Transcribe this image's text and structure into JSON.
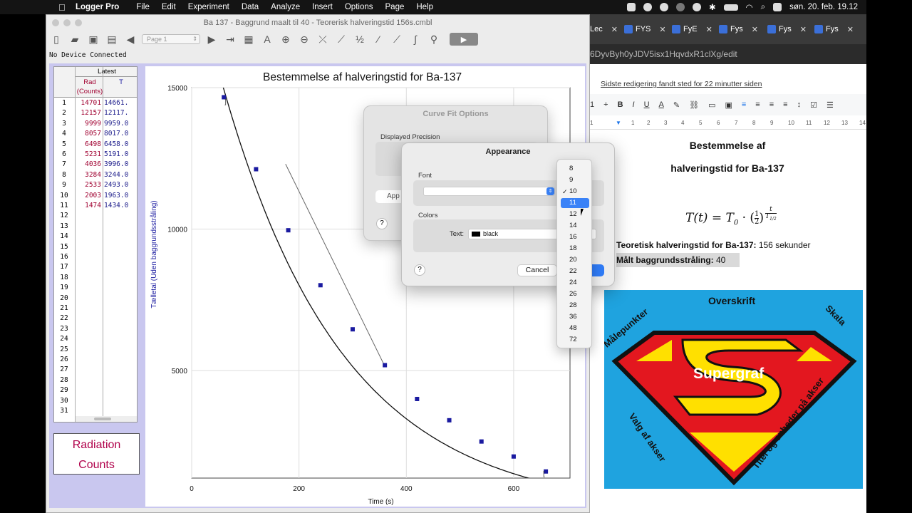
{
  "menubar": {
    "app": "Logger Pro",
    "items": [
      "File",
      "Edit",
      "Experiment",
      "Data",
      "Analyze",
      "Insert",
      "Options",
      "Page",
      "Help"
    ],
    "clock": "søn. 20. feb. 19.12"
  },
  "logger_window": {
    "title": "Ba 137 - Baggrund maalt til 40 - Teorerisk halveringstid 156s.cmbl",
    "page_select": "Page 1",
    "status": "No Device Connected"
  },
  "table": {
    "group": "Latest",
    "col1_header_line1": "Rad",
    "col1_header_line2": "(Counts)",
    "col2_header": "T",
    "rows": [
      {
        "n": "1",
        "a": "14701",
        "b": "14661."
      },
      {
        "n": "2",
        "a": "12157",
        "b": "12117."
      },
      {
        "n": "3",
        "a": "9999",
        "b": "9959.0"
      },
      {
        "n": "4",
        "a": "8057",
        "b": "8017.0"
      },
      {
        "n": "5",
        "a": "6498",
        "b": "6458.0"
      },
      {
        "n": "6",
        "a": "5231",
        "b": "5191.0"
      },
      {
        "n": "7",
        "a": "4036",
        "b": "3996.0"
      },
      {
        "n": "8",
        "a": "3284",
        "b": "3244.0"
      },
      {
        "n": "9",
        "a": "2533",
        "b": "2493.0"
      },
      {
        "n": "10",
        "a": "2003",
        "b": "1963.0"
      },
      {
        "n": "11",
        "a": "1474",
        "b": "1434.0"
      },
      {
        "n": "12",
        "a": "",
        "b": ""
      },
      {
        "n": "13",
        "a": "",
        "b": ""
      },
      {
        "n": "14",
        "a": "",
        "b": ""
      },
      {
        "n": "15",
        "a": "",
        "b": ""
      },
      {
        "n": "16",
        "a": "",
        "b": ""
      },
      {
        "n": "17",
        "a": "",
        "b": ""
      },
      {
        "n": "18",
        "a": "",
        "b": ""
      },
      {
        "n": "19",
        "a": "",
        "b": ""
      },
      {
        "n": "20",
        "a": "",
        "b": ""
      },
      {
        "n": "21",
        "a": "",
        "b": ""
      },
      {
        "n": "22",
        "a": "",
        "b": ""
      },
      {
        "n": "23",
        "a": "",
        "b": ""
      },
      {
        "n": "24",
        "a": "",
        "b": ""
      },
      {
        "n": "25",
        "a": "",
        "b": ""
      },
      {
        "n": "26",
        "a": "",
        "b": ""
      },
      {
        "n": "27",
        "a": "",
        "b": ""
      },
      {
        "n": "28",
        "a": "",
        "b": ""
      },
      {
        "n": "29",
        "a": "",
        "b": ""
      },
      {
        "n": "30",
        "a": "",
        "b": ""
      },
      {
        "n": "31",
        "a": "",
        "b": ""
      }
    ]
  },
  "meter": {
    "line1": "Radiation",
    "line2": "Counts",
    "color": "#b0004a"
  },
  "chart_data": {
    "type": "scatter",
    "title": "Bestemmelse af halveringstid for Ba-137",
    "xlabel": "Time (s)",
    "ylabel": "Tælletal (Uden baggrundsstråling)",
    "xlim": [
      0,
      705
    ],
    "ylim": [
      1200,
      15000
    ],
    "x_ticks": [
      0,
      200,
      400,
      600
    ],
    "y_ticks": [
      5000,
      10000,
      15000
    ],
    "grid": true,
    "points_color": "#1a1aa0",
    "series": [
      {
        "x": [
          60,
          120,
          180,
          240,
          300,
          360,
          420,
          480,
          540,
          600,
          660
        ],
        "y": [
          14661,
          12117,
          9959,
          8017,
          6458,
          5191,
          3996,
          3244,
          2493,
          1963,
          1434
        ]
      }
    ],
    "fit_curve": {
      "T0": 19500,
      "half_life": 156
    },
    "tangent": {
      "x": [
        175,
        360
      ],
      "y": [
        12300,
        5150
      ]
    }
  },
  "dialog_curvefit": {
    "title": "Curve Fit Options",
    "precision_label": "Displayed Precision",
    "appearance_btn": "App",
    "help": "?"
  },
  "dialog_appearance": {
    "title": "Appearance",
    "font_label": "Font",
    "colors_label": "Colors",
    "text_label": "Text:",
    "text_color": "black",
    "help": "?",
    "cancel": "Cancel"
  },
  "size_menu": {
    "items": [
      "8",
      "9",
      "10",
      "11",
      "12",
      "14",
      "16",
      "18",
      "20",
      "22",
      "24",
      "26",
      "28",
      "36",
      "48",
      "72"
    ],
    "checked": "10",
    "highlighted": "11"
  },
  "browser": {
    "tabs": [
      "Lec",
      "FYS",
      "FyE",
      "Fys",
      "Fys",
      "Fys"
    ],
    "url": "6DyvByh0yJDV5isx1HqvdxR1clXg/edit",
    "last_edit": "Sidste redigering fandt sted for 22 minutter siden",
    "toolbar": [
      "1",
      "+",
      "B",
      "I",
      "U",
      "A"
    ],
    "ruler": [
      "1",
      "1",
      "2",
      "3",
      "4",
      "5",
      "6",
      "7",
      "8",
      "9",
      "10",
      "11",
      "12",
      "13",
      "14"
    ],
    "doc": {
      "title_line1": "Bestemmelse af",
      "title_line2": "halveringstid for Ba-137",
      "formula_lhs": "T(t) = T",
      "formula_sub": "0",
      "formula_dot": " · (",
      "formula_frac_num": "1",
      "formula_frac_den": "2",
      "formula_close": ")",
      "formula_exp_num": "t",
      "formula_exp_den": "T",
      "formula_exp_den_sub": "1/2",
      "line1_bold": "Teoretisk halveringstid for Ba-137:",
      "line1_val": " 156 sekunder",
      "line2_bold": "Målt baggrundsstråling:",
      "line2_val": " 40"
    },
    "supergraf": {
      "center": "Supergraf",
      "top": "Overskrift",
      "left_top": "Målepunkter",
      "right_top": "Skala",
      "left_bottom": "Valg af akser",
      "right_bottom": "Titel og enheder på akser"
    }
  }
}
